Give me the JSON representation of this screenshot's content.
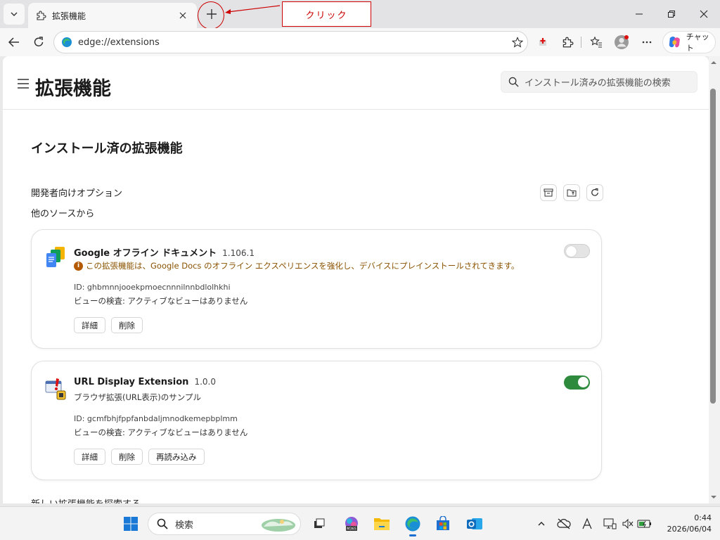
{
  "window": {
    "tab_title": "拡張機能",
    "annotation_label": "クリック"
  },
  "toolbar": {
    "url": "edge://extensions",
    "chat_label": "チャット"
  },
  "page": {
    "title": "拡張機能",
    "search_placeholder": "インストール済みの拡張機能の検索",
    "section_title": "インストール済の拡張機能",
    "developer_options": "開発者向けオプション",
    "other_sources": "他のソースから",
    "find_new": "新しい拡張機能を探索する"
  },
  "extensions": [
    {
      "name": "Google オフライン ドキュメント",
      "version": "1.106.1",
      "description": "この拡張機能は、Google Docs のオフライン エクスペリエンスを強化し、デバイスにプレインストールされてきます。",
      "id": "ID: ghbmnnjooekpmoecnnnilnnbdlolhkhi",
      "inspect": "ビューの検査: アクティブなビューはありません",
      "enabled": false,
      "buttons": [
        "詳細",
        "削除"
      ]
    },
    {
      "name": "URL Display Extension",
      "version": "1.0.0",
      "description": "ブラウザ拡張(URL表示)のサンプル",
      "id": "ID: gcmfbhjfppfanbdaljmnodkemepbplmm",
      "inspect": "ビューの検査: アクティブなビューはありません",
      "enabled": true,
      "buttons": [
        "詳細",
        "削除",
        "再読み込み"
      ]
    }
  ],
  "taskbar": {
    "search_label": "検索",
    "time": "0:44",
    "date": "2026/06/04"
  },
  "colors": {
    "toggle_on": "#2e8b3e",
    "warning_text": "#8a5300",
    "annotation": "#cc0000"
  }
}
